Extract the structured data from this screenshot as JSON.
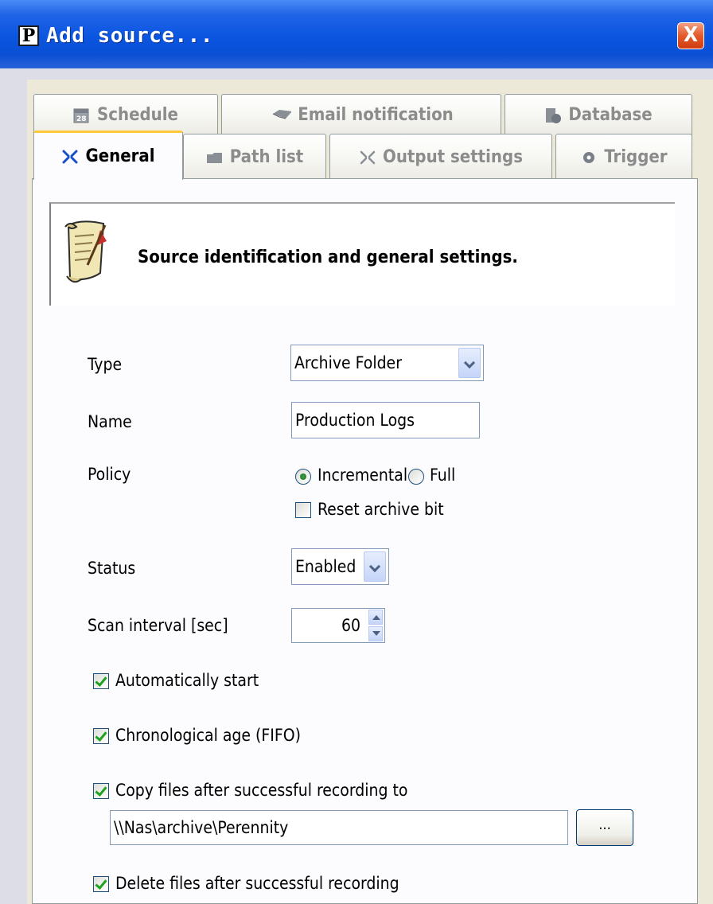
{
  "window": {
    "title": "Add source...",
    "app_icon_letter": "P",
    "close_label": "X"
  },
  "tabs_row1": [
    {
      "label": "Schedule",
      "icon": "calendar-icon"
    },
    {
      "label": "Email notification",
      "icon": "envelope-icon"
    },
    {
      "label": "Database",
      "icon": "database-icon"
    }
  ],
  "tabs_row2": [
    {
      "label": "General",
      "icon": "general-icon",
      "active": true
    },
    {
      "label": "Path list",
      "icon": "folder-icon"
    },
    {
      "label": "Output settings",
      "icon": "output-icon"
    },
    {
      "label": "Trigger",
      "icon": "gear-icon"
    }
  ],
  "header": {
    "text": "Source identification and general settings.",
    "icon": "scroll-icon"
  },
  "form": {
    "type_label": "Type",
    "type_value": "Archive Folder",
    "name_label": "Name",
    "name_value": "Production Logs",
    "policy_label": "Policy",
    "policy_incremental": "Incremental",
    "policy_full": "Full",
    "policy_selected": "Incremental",
    "reset_archive_label": "Reset archive bit",
    "reset_archive_checked": false,
    "status_label": "Status",
    "status_value": "Enabled",
    "scan_label": "Scan interval [sec]",
    "scan_value": "60",
    "auto_start_label": "Automatically start",
    "auto_start_checked": true,
    "fifo_label": "Chronological age (FIFO)",
    "fifo_checked": true,
    "copy_label": "Copy files after successful recording to",
    "copy_checked": true,
    "copy_path": "\\\\Nas\\archive\\Perennity",
    "browse_label": "...",
    "delete_label": "Delete files after successful recording",
    "delete_checked": true
  },
  "colors": {
    "titlebar": "#0a55e0",
    "active_tab_highlight": "#ffc83c",
    "close_button": "#e35a2a",
    "check": "#21a121"
  }
}
